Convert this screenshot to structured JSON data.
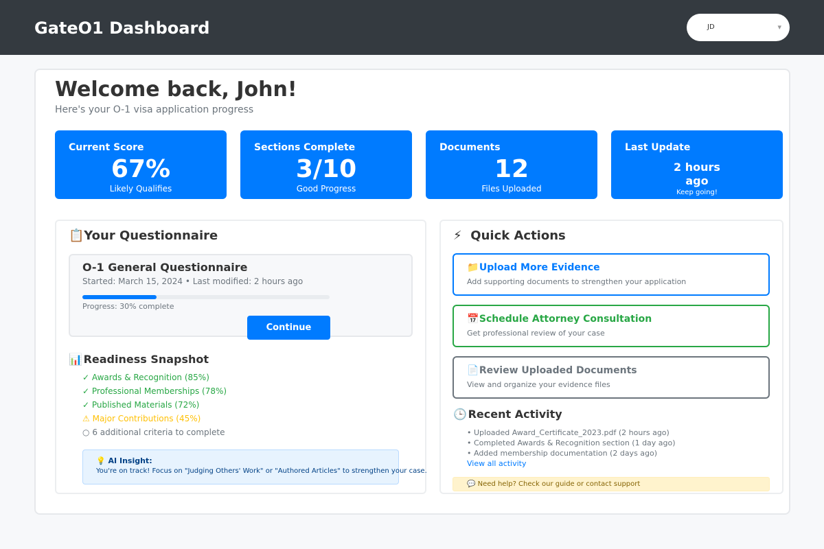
{
  "header": {
    "brand": "GateO1 Dashboard",
    "user": {
      "initials": "JD",
      "caret": "▾"
    }
  },
  "welcome": {
    "title": "Welcome back, John!",
    "subtitle": "Here's your O-1 visa application progress"
  },
  "stats": [
    {
      "label": "Current Score",
      "value": "67%",
      "sub": "Likely Qualifies"
    },
    {
      "label": "Sections Complete",
      "value": "3/10",
      "sub": "Good Progress"
    },
    {
      "label": "Documents",
      "value": "12",
      "sub": "Files Uploaded"
    },
    {
      "label": "Last Update",
      "value_line1": "2 hours",
      "value_line2": "ago",
      "sub": "Keep going!"
    }
  ],
  "questionnaire": {
    "icon": "clipboard-icon",
    "heading_icon": "📋",
    "heading": "Your Questionnaire",
    "card": {
      "title": "O-1 General Questionnaire",
      "meta": "Started: March 15, 2024 • Last modified: 2 hours ago",
      "progress_fraction": 0.3,
      "progress_text": "Progress: 30% complete",
      "button": "Continue"
    }
  },
  "readiness": {
    "icon": "chart-icon",
    "heading_icon": "📊",
    "heading": "Readiness Snapshot",
    "criteria": [
      {
        "icon": "✓",
        "text": "Awards & Recognition (85%)",
        "status": "complete"
      },
      {
        "icon": "✓",
        "text": "Professional Memberships (78%)",
        "status": "complete"
      },
      {
        "icon": "✓",
        "text": "Published Materials (72%)",
        "status": "complete"
      },
      {
        "icon": "⚠",
        "text": "Major Contributions (45%)",
        "status": "warning"
      },
      {
        "icon": "○",
        "text": "6 additional criteria to complete",
        "status": "pending"
      }
    ],
    "insight": {
      "icon": "💡",
      "title": "AI Insight:",
      "text": "You're on track! Focus on \"Judging Others' Work\" or \"Authored Articles\" to strengthen your case."
    }
  },
  "quick_actions": {
    "heading_icon": "⚡",
    "heading": "Quick Actions",
    "actions": [
      {
        "icon": "📁",
        "title": "Upload More Evidence",
        "desc": "Add supporting documents to strengthen your application",
        "color": "#007bff"
      },
      {
        "icon": "📅",
        "title": "Schedule Attorney Consultation",
        "desc": "Get professional review of your case",
        "color": "#28a745"
      },
      {
        "icon": "📄",
        "title": "Review Uploaded Documents",
        "desc": "View and organize your evidence files",
        "color": "#6c757d"
      }
    ]
  },
  "recent_activity": {
    "heading_icon": "🕒",
    "heading": "Recent Activity",
    "items": [
      "• Uploaded Award_Certificate_2023.pdf (2 hours ago)",
      "• Completed Awards & Recognition section (1 day ago)",
      "• Added membership documentation (2 days ago)"
    ],
    "view_all": "View all activity"
  },
  "help": {
    "icon": "💬",
    "text": "Need help? Check our guide or contact support"
  },
  "colors": {
    "topbar": "#343a40",
    "primary": "#007bff",
    "success": "#28a745",
    "warning": "#ffc107",
    "muted": "#6c757d"
  }
}
